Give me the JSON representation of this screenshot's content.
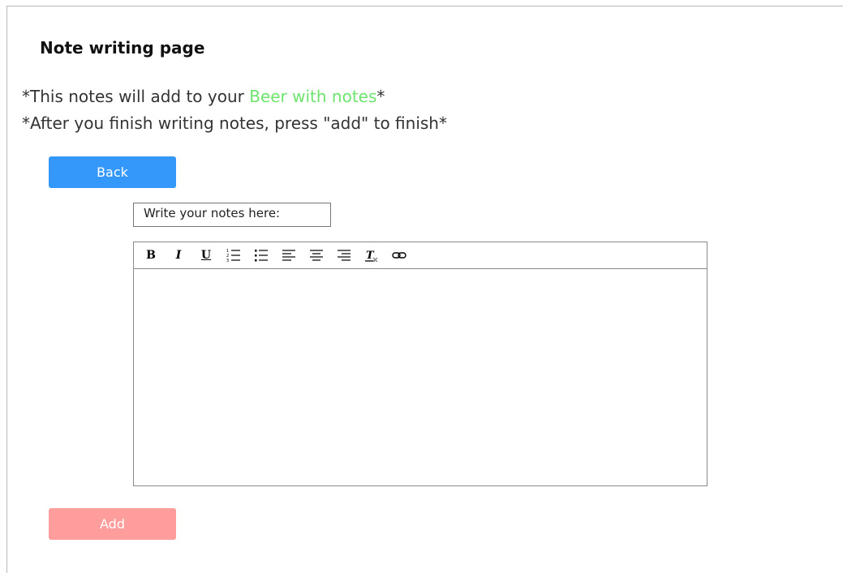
{
  "page": {
    "title": "Note writing page",
    "note1_prefix": "*This notes will add to your ",
    "note1_link": "Beer with notes",
    "note1_suffix": "*",
    "note2": "*After you finish writing notes, press \"add\" to finish*",
    "highlight_color": "#6ee36e"
  },
  "buttons": {
    "back_label": "Back",
    "add_label": "Add",
    "back_color": "#3498fb",
    "add_color": "#ff9d9d"
  },
  "editor": {
    "label": "Write your notes here:",
    "content": "",
    "toolbar": {
      "bold": "B",
      "italic": "I",
      "underline": "U",
      "icons": [
        "bold-icon",
        "italic-icon",
        "underline-icon",
        "ordered-list-icon",
        "bullet-list-icon",
        "align-left-icon",
        "align-center-icon",
        "align-right-icon",
        "clear-format-icon",
        "link-icon"
      ]
    }
  }
}
